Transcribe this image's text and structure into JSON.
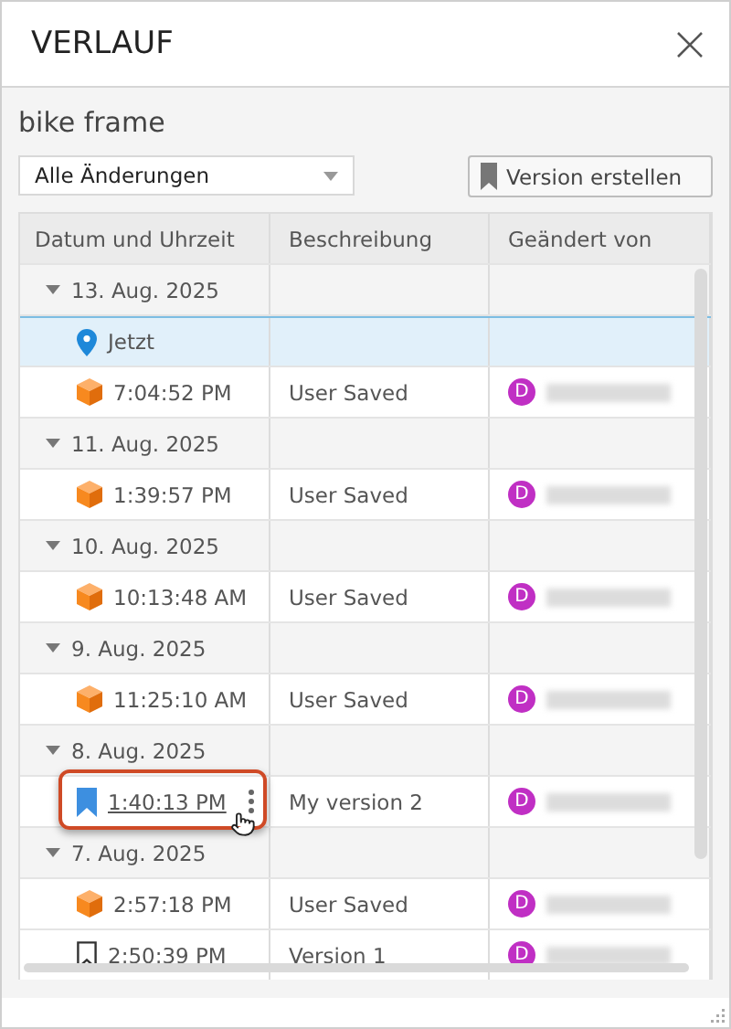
{
  "window": {
    "title": "VERLAUF"
  },
  "document": {
    "name": "bike frame"
  },
  "filter": {
    "value": "Alle Änderungen"
  },
  "create_button": {
    "label": "Version erstellen"
  },
  "table": {
    "columns": [
      "Datum und Uhrzeit",
      "Beschreibung",
      "Geändert von"
    ],
    "groups": [
      {
        "date": "13. Aug. 2025",
        "expanded": true,
        "entries": [
          {
            "kind": "current",
            "time": "Jetzt",
            "selected": true,
            "hovered": false
          },
          {
            "kind": "autosave",
            "time": "7:04:52 PM",
            "description": "User Saved",
            "avatar": "D",
            "selected": false,
            "hovered": false
          }
        ]
      },
      {
        "date": "11. Aug. 2025",
        "expanded": true,
        "entries": [
          {
            "kind": "autosave",
            "time": "1:39:57 PM",
            "description": "User Saved",
            "avatar": "D",
            "selected": false,
            "hovered": false
          }
        ]
      },
      {
        "date": "10. Aug. 2025",
        "expanded": true,
        "entries": [
          {
            "kind": "autosave",
            "time": "10:13:48 AM",
            "description": "User Saved",
            "avatar": "D",
            "selected": false,
            "hovered": false
          }
        ]
      },
      {
        "date": "9. Aug. 2025",
        "expanded": true,
        "entries": [
          {
            "kind": "autosave",
            "time": "11:25:10 AM",
            "description": "User Saved",
            "avatar": "D",
            "selected": false,
            "hovered": false
          }
        ]
      },
      {
        "date": "8. Aug. 2025",
        "expanded": true,
        "entries": [
          {
            "kind": "version",
            "time": "1:40:13 PM",
            "description": "My version 2",
            "avatar": "D",
            "selected": false,
            "hovered": true
          }
        ]
      },
      {
        "date": "7. Aug. 2025",
        "expanded": true,
        "entries": [
          {
            "kind": "autosave",
            "time": "2:57:18 PM",
            "description": "User Saved",
            "avatar": "D",
            "selected": false,
            "hovered": false
          },
          {
            "kind": "milestone",
            "time": "2:50:39 PM",
            "description": "Version 1",
            "avatar": "D",
            "selected": false,
            "hovered": false
          }
        ]
      }
    ]
  }
}
